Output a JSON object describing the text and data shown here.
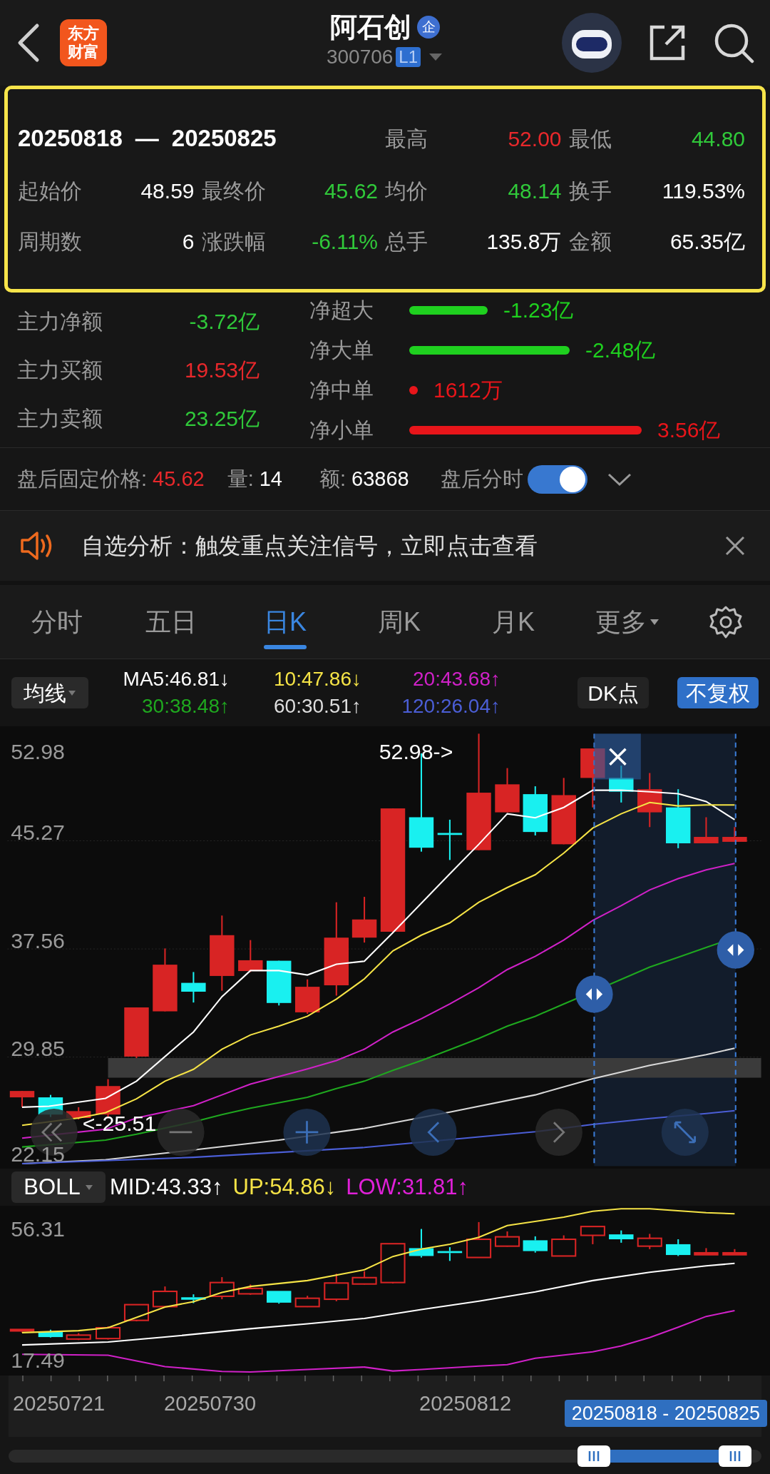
{
  "header": {
    "logo_lines": [
      "东方",
      "财富"
    ],
    "title": "阿石创",
    "title_badge": "企",
    "code": "300706",
    "level_badge": "L1"
  },
  "period_summary": {
    "range_start": "20250818",
    "range_separator": "—",
    "range_end": "20250825",
    "stats": [
      {
        "label": "最高",
        "value": "52.00",
        "color": "#e8282b"
      },
      {
        "label": "最低",
        "value": "44.80",
        "color": "#30c93a"
      },
      {
        "label": "起始价",
        "value": "48.59",
        "color": "#ffffff"
      },
      {
        "label": "最终价",
        "value": "45.62",
        "color": "#30c93a"
      },
      {
        "label": "均价",
        "value": "48.14",
        "color": "#30c93a"
      },
      {
        "label": "换手",
        "value": "119.53%",
        "color": "#ffffff"
      },
      {
        "label": "周期数",
        "value": "6",
        "color": "#ffffff"
      },
      {
        "label": "涨跌幅",
        "value": "-6.11%",
        "color": "#30c93a"
      },
      {
        "label": "总手",
        "value": "135.8万",
        "color": "#ffffff"
      },
      {
        "label": "金额",
        "value": "65.35亿",
        "color": "#ffffff"
      }
    ]
  },
  "main_force": [
    {
      "label": "主力净额",
      "value": "-3.72亿",
      "color": "#30c93a"
    },
    {
      "label": "主力买额",
      "value": "19.53亿",
      "color": "#e8282b"
    },
    {
      "label": "主力卖额",
      "value": "23.25亿",
      "color": "#30c93a"
    }
  ],
  "order_flow": [
    {
      "label": "净超大",
      "value": "-1.23亿",
      "color": "#1fd01f"
    },
    {
      "label": "净大单",
      "value": "-2.48亿",
      "color": "#1fd01f"
    },
    {
      "label": "净中单",
      "value": "1612万",
      "color": "#e8151a"
    },
    {
      "label": "净小单",
      "value": "3.56亿",
      "color": "#e8151a"
    }
  ],
  "after_hours": {
    "items": [
      {
        "label": "盘后固定价格:",
        "value": "45.62",
        "color": "#e8282b"
      },
      {
        "label": "量:",
        "value": "14",
        "color": "#ffffff"
      },
      {
        "label": "额:",
        "value": "63868",
        "color": "#ffffff"
      }
    ],
    "toggle": {
      "label": "盘后分时",
      "on": true
    }
  },
  "notice": {
    "text": "自选分析：触发重点关注信号，立即点击查看"
  },
  "tabs": [
    {
      "label": "分时",
      "kind": "tab",
      "selected": false
    },
    {
      "label": "五日",
      "kind": "tab",
      "selected": false
    },
    {
      "label": "日K",
      "kind": "tab",
      "selected": true
    },
    {
      "label": "周K",
      "kind": "tab",
      "selected": false
    },
    {
      "label": "月K",
      "kind": "tab",
      "selected": false
    },
    {
      "label": "更多",
      "kind": "menu",
      "selected": false
    }
  ],
  "indicator_bar": {
    "selector": "均线",
    "values": [
      {
        "text": "MA5:46.81↓",
        "color": "#ffffff"
      },
      {
        "text": "10:47.86↓",
        "color": "#f5e346"
      },
      {
        "text": "20:43.68↑",
        "color": "#d021c8"
      },
      {
        "text": "30:38.48↑",
        "color": "#1fa81f"
      },
      {
        "text": "60:30.51↑",
        "color": "#dddddd"
      },
      {
        "text": "120:26.04↑",
        "color": "#4b5ed6"
      }
    ],
    "dk_button": "DK点",
    "adjust_button": "不复权"
  },
  "main_chart": {
    "y_labels": [
      "52.98",
      "45.27",
      "37.56",
      "29.85",
      "22.15"
    ],
    "high_marker": "52.98->",
    "low_marker": "<-25.51"
  },
  "boll_bar": {
    "selector": "BOLL",
    "values": [
      {
        "text": "MID:43.33↑",
        "color": "#ffffff"
      },
      {
        "text": "UP:54.86↓",
        "color": "#f5e346"
      },
      {
        "text": "LOW:31.81↑",
        "color": "#e020d8"
      }
    ]
  },
  "boll_chart": {
    "y_labels": [
      "56.31",
      "17.49"
    ]
  },
  "date_axis": [
    "20250721",
    "20250730",
    "20250812"
  ],
  "range_tooltip": "20250818 - 20250825"
}
